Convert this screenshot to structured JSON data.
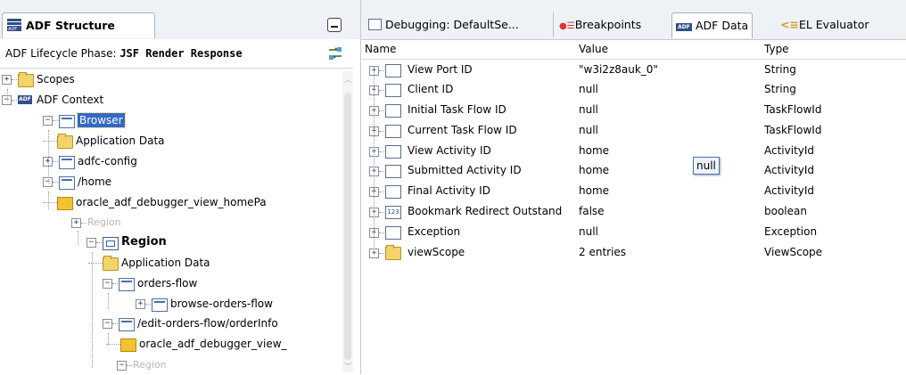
{
  "left": {
    "tab_title": "ADF Structure",
    "phase_label": "ADF Lifecycle Phase:",
    "phase_value": "JSF Render Response",
    "tree": [
      {
        "label": "Scopes",
        "icon": "folder-icon"
      },
      {
        "label": "ADF Context",
        "icon": "adf-icon"
      },
      {
        "label": "Browser",
        "icon": "browser-icon",
        "selected": true
      },
      {
        "label": "Application Data",
        "icon": "folder-icon"
      },
      {
        "label": "adfc-config",
        "icon": "taskflow-icon"
      },
      {
        "label": "/home",
        "icon": "page-icon"
      },
      {
        "label": "oracle_adf_debugger_view_homePa",
        "icon": "jsp-icon"
      },
      {
        "label": "Region",
        "icon": "none",
        "disabled": true
      },
      {
        "label": "Region",
        "icon": "region-icon",
        "bold": true
      },
      {
        "label": "Application Data",
        "icon": "folder-icon"
      },
      {
        "label": "orders-flow",
        "icon": "taskflow-icon"
      },
      {
        "label": "browse-orders-flow",
        "icon": "taskflow-icon"
      },
      {
        "label": "/edit-orders-flow/orderInfo",
        "icon": "activity-icon"
      },
      {
        "label": "oracle_adf_debugger_view_",
        "icon": "jsp-icon"
      },
      {
        "label": "Region",
        "icon": "none",
        "disabled": true
      }
    ]
  },
  "right": {
    "tabs": [
      {
        "label": "Debugging: DefaultSe...",
        "icon": "debug-icon"
      },
      {
        "label": "Breakpoints",
        "icon": "breakpoint-icon"
      },
      {
        "label": "ADF Data",
        "icon": "adf-icon",
        "active": true
      },
      {
        "label": "EL Evaluator",
        "icon": "el-icon"
      }
    ],
    "columns": {
      "name": "Name",
      "value": "Value",
      "type": "Type"
    },
    "rows": [
      {
        "name": "View Port ID",
        "value": "\"w3i2z8auk_0\"",
        "type": "String"
      },
      {
        "name": "Client ID",
        "value": "null",
        "type": "String"
      },
      {
        "name": "Initial Task Flow ID",
        "value": "null",
        "type": "TaskFlowId"
      },
      {
        "name": "Current Task Flow ID",
        "value": "null",
        "type": "TaskFlowId"
      },
      {
        "name": "View Activity ID",
        "value": "home",
        "type": "ActivityId"
      },
      {
        "name": "Submitted Activity ID",
        "value": "home",
        "type": "ActivityId"
      },
      {
        "name": "Final Activity ID",
        "value": "home",
        "type": "ActivityId"
      },
      {
        "name": "Bookmark Redirect Outstand",
        "value": "false",
        "type": "boolean"
      },
      {
        "name": "Exception",
        "value": "null",
        "type": "Exception"
      },
      {
        "name": "viewScope",
        "value": "2 entries",
        "type": "ViewScope"
      }
    ],
    "tooltip": "null"
  },
  "colors": {
    "selection": "#3169c6",
    "tab_bg": "#eef1f6",
    "border": "#a9b4c6"
  }
}
